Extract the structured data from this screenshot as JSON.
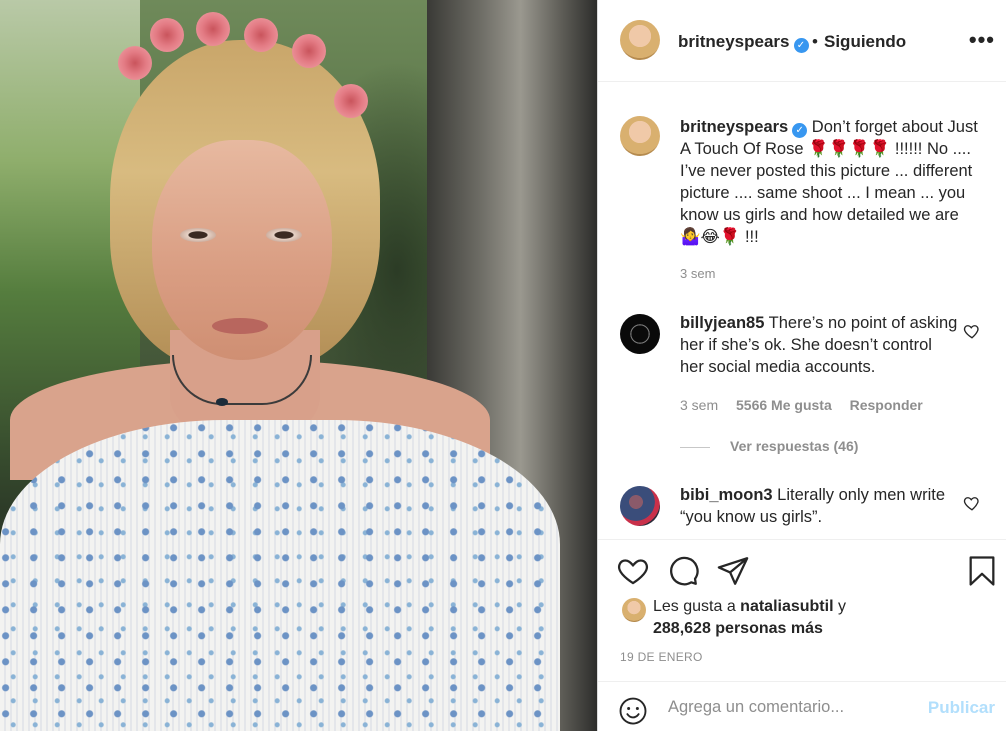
{
  "post": {
    "image_alt": "",
    "author": "britneyspears",
    "verified": true,
    "follow_separator": "•",
    "follow_status": "Siguiendo",
    "more_label": "•••"
  },
  "caption": {
    "username": "britneyspears",
    "text": " Don’t forget about Just A Touch Of Rose 🌹🌹🌹🌹 !!!!!! No .... I’ve never posted this picture ... different picture .... same shoot ... I mean ... you know us girls and how detailed we are 🤷‍♀️😂🌹 !!!",
    "time": "3 sem"
  },
  "comments": [
    {
      "username": "billyjean85",
      "text": " There’s no point of asking her if she’s ok. She doesn’t control her social media accounts.",
      "time": "3 sem",
      "likes": "5566 Me gusta",
      "reply_label": "Responder",
      "view_replies": "Ver respuestas (46)"
    },
    {
      "username": "bibi_moon3",
      "text": " Literally only men write “you know us girls”."
    }
  ],
  "likes": {
    "prefix": "Les gusta a ",
    "liker": "nataliasubtil",
    "connector": " y",
    "others": "288,628 personas más"
  },
  "date": "19 DE ENERO",
  "add_comment": {
    "placeholder": "Agrega un comentario...",
    "publish_label": "Publicar"
  },
  "colors": {
    "verified_blue": "#3897f0",
    "muted_text": "#8e8e8e",
    "publish_disabled": "#b2dffc"
  }
}
